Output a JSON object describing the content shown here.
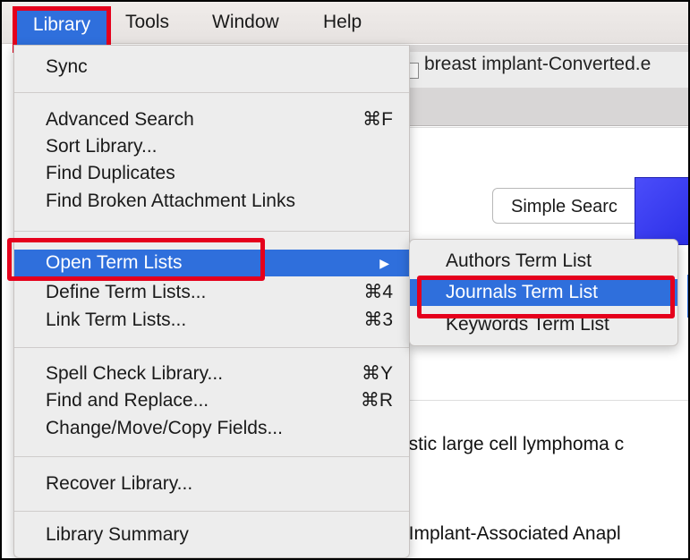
{
  "menubar": {
    "items": [
      "Library",
      "Tools",
      "Window",
      "Help"
    ]
  },
  "background": {
    "tab_title": "breast implant-Converted.e",
    "simple_search": "Simple Searc",
    "row1": "astic large cell lymphoma c",
    "row2": "t Implant-Associated Anapl"
  },
  "library_menu": {
    "sync": "Sync",
    "advanced_search": "Advanced Search",
    "advanced_search_sc": "⌘F",
    "sort_library": "Sort Library...",
    "find_duplicates": "Find Duplicates",
    "find_broken": "Find Broken Attachment Links",
    "open_term_lists": "Open Term Lists",
    "submenu_arrow": "▶",
    "define_term_lists": "Define Term Lists...",
    "define_term_lists_sc": "⌘4",
    "link_term_lists": "Link Term Lists...",
    "link_term_lists_sc": "⌘3",
    "spell_check": "Spell Check Library...",
    "spell_check_sc": "⌘Y",
    "find_replace": "Find and Replace...",
    "find_replace_sc": "⌘R",
    "change_fields": "Change/Move/Copy Fields...",
    "recover": "Recover Library...",
    "summary": "Library Summary"
  },
  "term_submenu": {
    "authors": "Authors Term List",
    "journals": "Journals Term List",
    "keywords": "Keywords Term List"
  },
  "colors": {
    "highlight": "#2f6fdc",
    "annotation_red": "#e5001c"
  }
}
